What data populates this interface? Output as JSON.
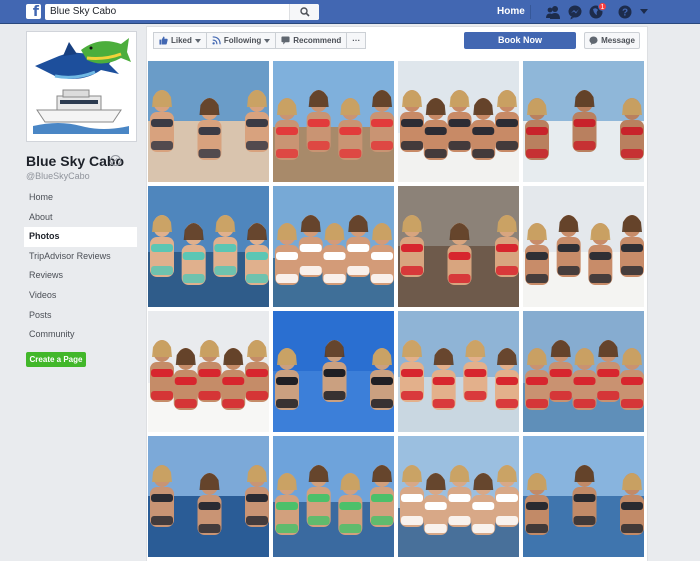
{
  "topbar": {
    "search_value": "Blue Sky Cabo",
    "home_label": "Home",
    "notifications_count": "1"
  },
  "page": {
    "name": "Blue Sky Cabo",
    "handle": "@BlueSkyCabo"
  },
  "nav": {
    "items": [
      {
        "label": "Home",
        "active": false
      },
      {
        "label": "About",
        "active": false
      },
      {
        "label": "Photos",
        "active": true
      },
      {
        "label": "TripAdvisor Reviews",
        "active": false
      },
      {
        "label": "Reviews",
        "active": false
      },
      {
        "label": "Videos",
        "active": false
      },
      {
        "label": "Posts",
        "active": false
      },
      {
        "label": "Community",
        "active": false
      }
    ],
    "create_page_label": "Create a Page"
  },
  "actions": {
    "liked_label": "Liked",
    "following_label": "Following",
    "recommend_label": "Recommend",
    "more_label": "···",
    "book_now_label": "Book Now",
    "message_label": "Message"
  },
  "colors": {
    "brand_blue": "#4267b2",
    "create_green": "#42b72a"
  },
  "photos": [
    {
      "alt": "group on boat stern",
      "sky": "#6a9cc8",
      "bg": "#d9c4ae",
      "skin": "#d8a27e",
      "accent": "#3b3b45"
    },
    {
      "alt": "crowd at arch rocks",
      "sky": "#7fb0dc",
      "bg": "#a88a6a",
      "skin": "#c99473",
      "accent": "#e23b3b"
    },
    {
      "alt": "group on yacht bow",
      "sky": "#dfe6ec",
      "bg": "#f2f2f0",
      "skin": "#c88a66",
      "accent": "#2c2c34"
    },
    {
      "alt": "group posing on deck",
      "sky": "#8fb7d9",
      "bg": "#e7ecef",
      "skin": "#b9805f",
      "accent": "#c8232b"
    },
    {
      "alt": "two girls selfie",
      "sky": "#4f86bd",
      "bg": "#2f5c8a",
      "skin": "#e0b08d",
      "accent": "#5bc6b4"
    },
    {
      "alt": "girl dancing",
      "sky": "#77a9d6",
      "bg": "#3f6f98",
      "skin": "#d39b78",
      "accent": "#ffffff"
    },
    {
      "alt": "girls with red cups",
      "sky": "#8c8278",
      "bg": "#6e5a4b",
      "skin": "#d8a57f",
      "accent": "#d7262e"
    },
    {
      "alt": "group on white boat",
      "sky": "#e4e8ec",
      "bg": "#f4f4f2",
      "skin": "#c88c69",
      "accent": "#2f2f35"
    },
    {
      "alt": "group under canopy",
      "sky": "#e9ebee",
      "bg": "#f7f7f5",
      "skin": "#c58c68",
      "accent": "#d7262e"
    },
    {
      "alt": "guys cheering",
      "sky": "#2a6fd1",
      "bg": "#3c7fd9",
      "skin": "#caa080",
      "accent": "#1f1f24"
    },
    {
      "alt": "girls close up",
      "sky": "#8fb4d6",
      "bg": "#c9d7e1",
      "skin": "#e3b08b",
      "accent": "#d7262e"
    },
    {
      "alt": "group with cups",
      "sky": "#86acd0",
      "bg": "#5f8fb9",
      "skin": "#c99271",
      "accent": "#d7262e"
    },
    {
      "alt": "girls on deck ocean",
      "sky": "#7ca9d8",
      "bg": "#2a5c96",
      "skin": "#c99474",
      "accent": "#2b2b33"
    },
    {
      "alt": "girls by cruise ship",
      "sky": "#6ea3db",
      "bg": "#3a6aa0",
      "skin": "#d2a07d",
      "accent": "#4cc06a"
    },
    {
      "alt": "two girls laughing",
      "sky": "#9bbfe0",
      "bg": "#48709a",
      "skin": "#d8a887",
      "accent": "#ffffff"
    },
    {
      "alt": "trio on boat",
      "sky": "#88b4de",
      "bg": "#3f75ae",
      "skin": "#c28a67",
      "accent": "#2a2a30"
    }
  ]
}
